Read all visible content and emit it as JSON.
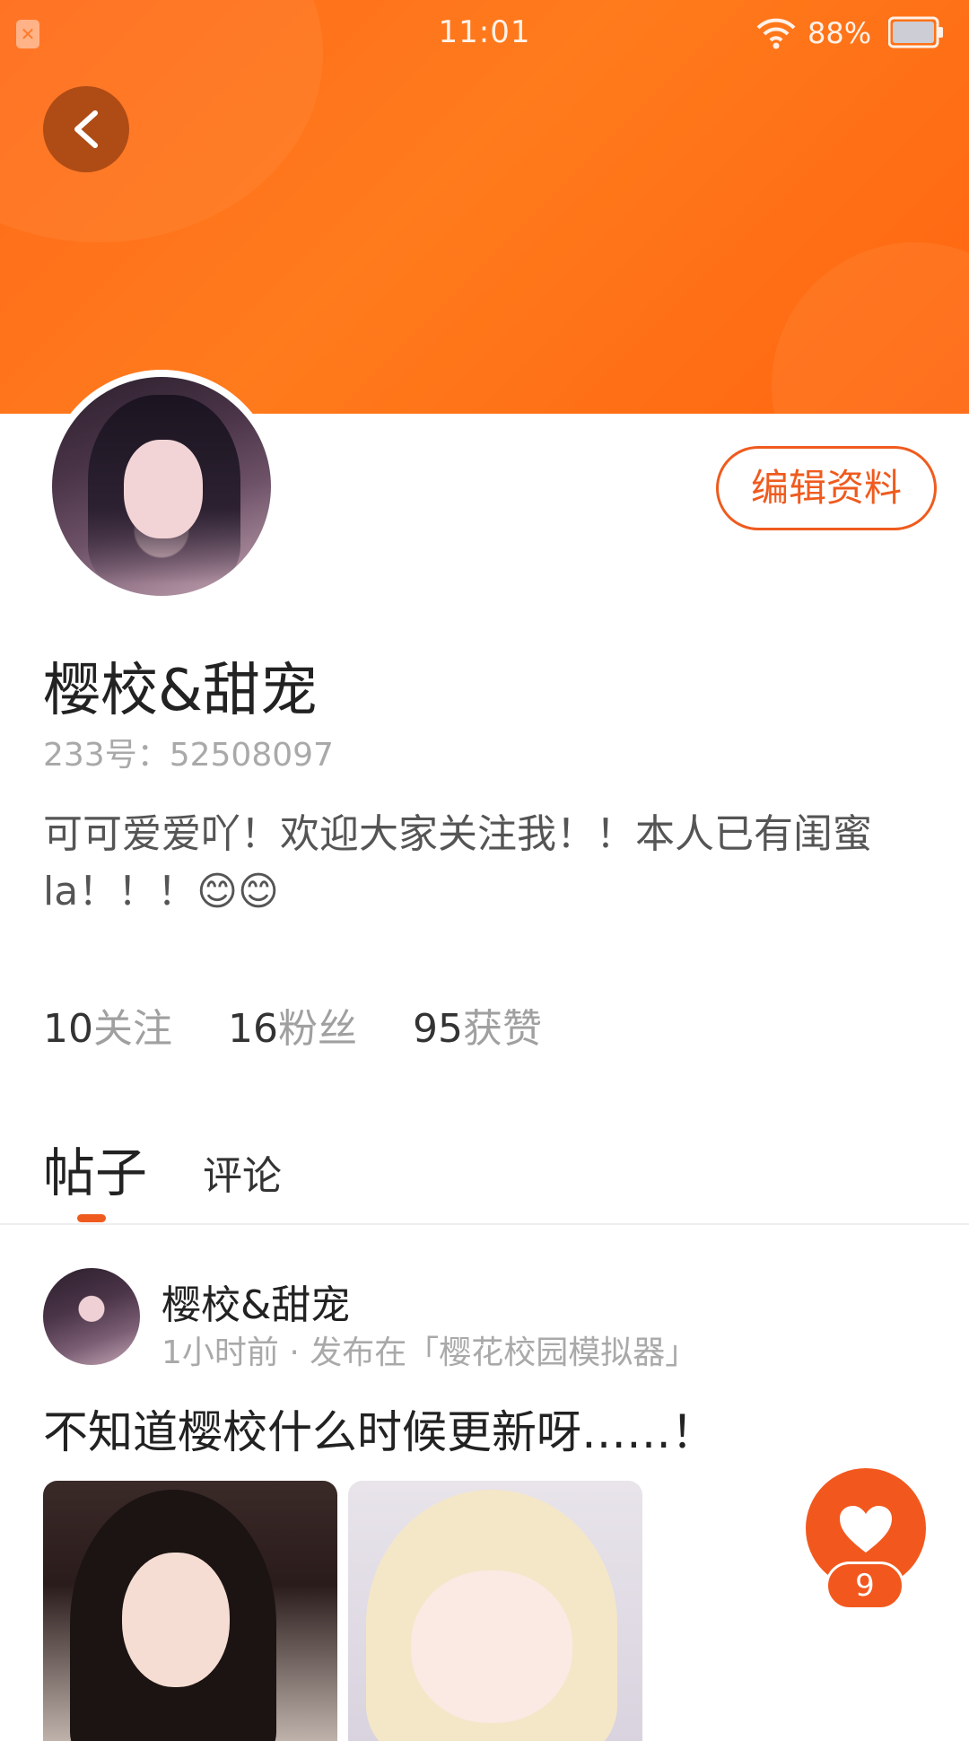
{
  "status_bar": {
    "time": "11:01",
    "battery": "88%"
  },
  "header": {
    "back_icon": "chevron-left-icon",
    "colors": {
      "accent": "#ef5b1e",
      "header_bg": "#ff7317"
    }
  },
  "profile": {
    "edit_label": "编辑资料",
    "name": "樱校&甜宠",
    "id_text": "233号：52508097",
    "bio": "可可爱爱吖！欢迎大家关注我！！本人已有闺蜜la！！！😊😊",
    "stats": [
      {
        "value": "10",
        "label": "关注"
      },
      {
        "value": "16",
        "label": "粉丝"
      },
      {
        "value": "95",
        "label": "获赞"
      }
    ]
  },
  "tabs": [
    {
      "label": "帖子",
      "active": true
    },
    {
      "label": "评论",
      "active": false
    }
  ],
  "post": {
    "author": "樱校&甜宠",
    "meta": "1小时前 · 发布在「樱花校园模拟器」",
    "text": "不知道樱校什么时候更新呀……！",
    "like_count": "9"
  }
}
